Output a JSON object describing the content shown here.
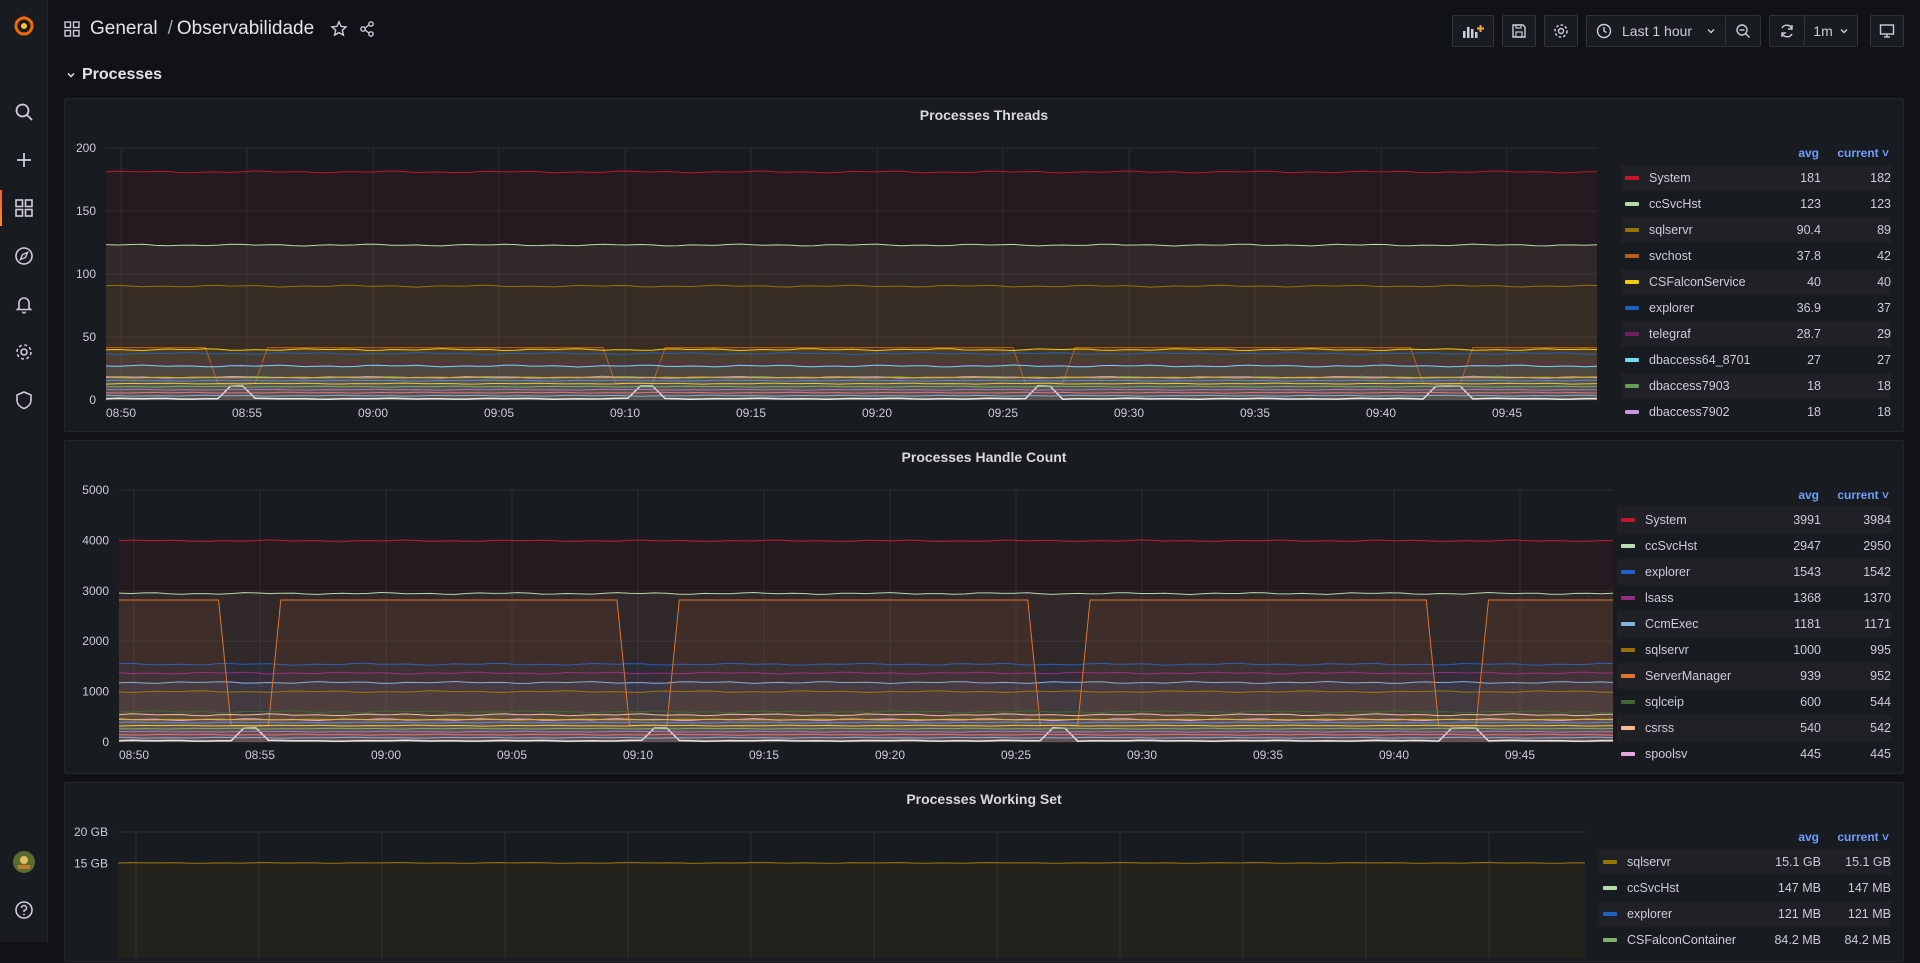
{
  "breadcrumb": {
    "folder": "General",
    "separator": "/",
    "dashboard": "Observabilidade"
  },
  "toolbar": {
    "time_range": "Last 1 hour",
    "refresh_interval": "1m"
  },
  "row": {
    "title": "Processes"
  },
  "colors": {
    "System": "#c4162a",
    "ccSvcHst": "#b7dbab",
    "sqlservr": "#967302",
    "svchost": "#c15c17",
    "CSFalconService": "#f2cc0c",
    "explorer": "#1f60c4",
    "telegraf": "#6d1f62",
    "dbaccess64_8701": "#70dbed",
    "dbaccess7903": "#629e51",
    "dbaccess7902": "#ca95e5",
    "lsass": "#962d82",
    "CcmExec": "#82b5d8",
    "ServerManager": "#e0752d",
    "sqlceip": "#3f6833",
    "csrss": "#f9ba8f",
    "spoolsv": "#e5a8e2",
    "CSFalconContainer": "#7eb26d"
  },
  "panels": [
    {
      "title": "Processes Threads",
      "legend": {
        "avg_label": "avg",
        "current_label": "current ˅"
      },
      "legend_rows": [
        {
          "name": "System",
          "avg": "181",
          "current": "182"
        },
        {
          "name": "ccSvcHst",
          "avg": "123",
          "current": "123"
        },
        {
          "name": "sqlservr",
          "avg": "90.4",
          "current": "89"
        },
        {
          "name": "svchost",
          "avg": "37.8",
          "current": "42"
        },
        {
          "name": "CSFalconService",
          "avg": "40",
          "current": "40"
        },
        {
          "name": "explorer",
          "avg": "36.9",
          "current": "37"
        },
        {
          "name": "telegraf",
          "avg": "28.7",
          "current": "29"
        },
        {
          "name": "dbaccess64_8701",
          "avg": "27",
          "current": "27"
        },
        {
          "name": "dbaccess7903",
          "avg": "18",
          "current": "18"
        },
        {
          "name": "dbaccess7902",
          "avg": "18",
          "current": "18"
        }
      ],
      "chart_data": {
        "type": "area",
        "x": [
          "08:50",
          "08:55",
          "09:00",
          "09:05",
          "09:10",
          "09:15",
          "09:20",
          "09:25",
          "09:30",
          "09:35",
          "09:40",
          "09:45"
        ],
        "ylim": [
          0,
          200
        ],
        "yticks": [
          "0",
          "50",
          "100",
          "150",
          "200"
        ],
        "series": [
          {
            "name": "System",
            "values": [
              181,
              182
            ]
          },
          {
            "name": "ccSvcHst",
            "values": [
              123,
              123
            ]
          },
          {
            "name": "sqlservr",
            "values": [
              90.4,
              89
            ]
          },
          {
            "name": "svchost",
            "values": [
              37.8,
              42
            ]
          },
          {
            "name": "CSFalconService",
            "values": [
              40,
              40
            ]
          },
          {
            "name": "explorer",
            "values": [
              36.9,
              37
            ]
          },
          {
            "name": "telegraf",
            "values": [
              28.7,
              29
            ]
          },
          {
            "name": "dbaccess64_8701",
            "values": [
              27,
              27
            ]
          },
          {
            "name": "dbaccess7903",
            "values": [
              18,
              18
            ]
          },
          {
            "name": "dbaccess7902",
            "values": [
              18,
              18
            ]
          }
        ]
      }
    },
    {
      "title": "Processes Handle Count",
      "legend": {
        "avg_label": "avg",
        "current_label": "current ˅"
      },
      "legend_rows": [
        {
          "name": "System",
          "avg": "3991",
          "current": "3984"
        },
        {
          "name": "ccSvcHst",
          "avg": "2947",
          "current": "2950"
        },
        {
          "name": "explorer",
          "avg": "1543",
          "current": "1542"
        },
        {
          "name": "lsass",
          "avg": "1368",
          "current": "1370"
        },
        {
          "name": "CcmExec",
          "avg": "1181",
          "current": "1171"
        },
        {
          "name": "sqlservr",
          "avg": "1000",
          "current": "995"
        },
        {
          "name": "ServerManager",
          "avg": "939",
          "current": "952"
        },
        {
          "name": "sqlceip",
          "avg": "600",
          "current": "544"
        },
        {
          "name": "csrss",
          "avg": "540",
          "current": "542"
        },
        {
          "name": "spoolsv",
          "avg": "445",
          "current": "445"
        }
      ],
      "chart_data": {
        "type": "area",
        "x": [
          "08:50",
          "08:55",
          "09:00",
          "09:05",
          "09:10",
          "09:15",
          "09:20",
          "09:25",
          "09:30",
          "09:35",
          "09:40",
          "09:45"
        ],
        "ylim": [
          0,
          5000
        ],
        "yticks": [
          "0",
          "1000",
          "2000",
          "3000",
          "4000",
          "5000"
        ],
        "series": [
          {
            "name": "System",
            "values": [
              3991,
              3984
            ]
          },
          {
            "name": "ccSvcHst",
            "values": [
              2947,
              2950
            ]
          },
          {
            "name": "explorer",
            "values": [
              1543,
              1542
            ]
          },
          {
            "name": "lsass",
            "values": [
              1368,
              1370
            ]
          },
          {
            "name": "CcmExec",
            "values": [
              1181,
              1171
            ]
          },
          {
            "name": "sqlservr",
            "values": [
              1000,
              995
            ]
          },
          {
            "name": "ServerManager",
            "values": [
              939,
              952
            ]
          },
          {
            "name": "sqlceip",
            "values": [
              600,
              544
            ]
          },
          {
            "name": "csrss",
            "values": [
              540,
              542
            ]
          },
          {
            "name": "spoolsv",
            "values": [
              445,
              445
            ]
          }
        ]
      }
    },
    {
      "title": "Processes Working Set",
      "legend": {
        "avg_label": "avg",
        "current_label": "current ˅"
      },
      "legend_rows": [
        {
          "name": "sqlservr",
          "avg": "15.1 GB",
          "current": "15.1 GB"
        },
        {
          "name": "ccSvcHst",
          "avg": "147 MB",
          "current": "147 MB"
        },
        {
          "name": "explorer",
          "avg": "121 MB",
          "current": "121 MB"
        },
        {
          "name": "CSFalconContainer",
          "avg": "84.2 MB",
          "current": "84.2 MB"
        }
      ],
      "chart_data": {
        "type": "area",
        "ylim": [
          0,
          20
        ],
        "yticks": [
          "15 GB",
          "20 GB"
        ],
        "series": [
          {
            "name": "sqlservr",
            "values": [
              15.1,
              15.1
            ]
          }
        ]
      }
    }
  ]
}
